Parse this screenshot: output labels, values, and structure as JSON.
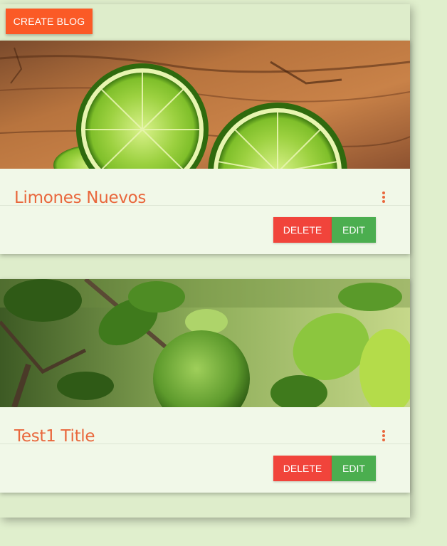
{
  "toolbar": {
    "create_label": "CREATE BLOG"
  },
  "cards": [
    {
      "title": "Limones Nuevos",
      "delete_label": "DELETE",
      "edit_label": "EDIT",
      "image": "cut-limes-on-wood"
    },
    {
      "title": "Test1 Title",
      "delete_label": "DELETE",
      "edit_label": "EDIT",
      "image": "lime-on-tree"
    }
  ],
  "colors": {
    "accent": "#fb5a26",
    "title": "#e9673c",
    "delete": "#f1443b",
    "edit": "#4bae4f",
    "card": "#f1f8e8",
    "background": "#e0efcd"
  },
  "icons": {
    "card_menu": "more-vert-icon"
  }
}
